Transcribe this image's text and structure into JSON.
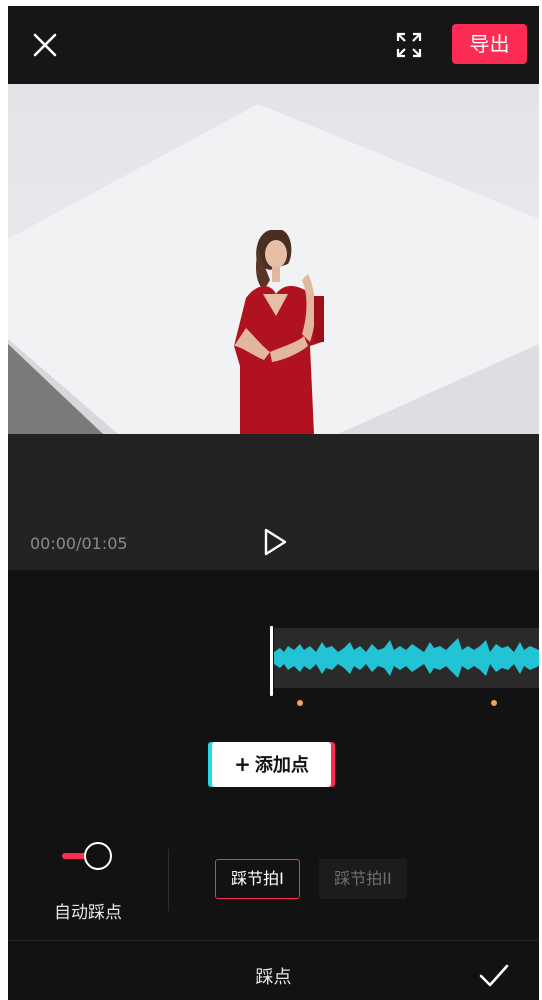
{
  "header": {
    "close_icon": "close-icon",
    "fullscreen_icon": "fullscreen-icon",
    "export_label": "导出",
    "accent_color": "#fd2c55"
  },
  "player": {
    "timecode": "00:00/01:05",
    "play_icon": "play-icon"
  },
  "timeline": {
    "waveform_color": "#22c3d4",
    "beat_marker_color": "#f5a44f"
  },
  "add_point": {
    "plus": "+",
    "label": "添加点"
  },
  "auto_beat": {
    "label": "自动踩点",
    "enabled": true
  },
  "beat_modes": [
    {
      "label": "踩节拍I",
      "selected": true
    },
    {
      "label": "踩节拍II",
      "selected": false
    }
  ],
  "footer": {
    "title": "踩点",
    "confirm_icon": "check-icon"
  }
}
